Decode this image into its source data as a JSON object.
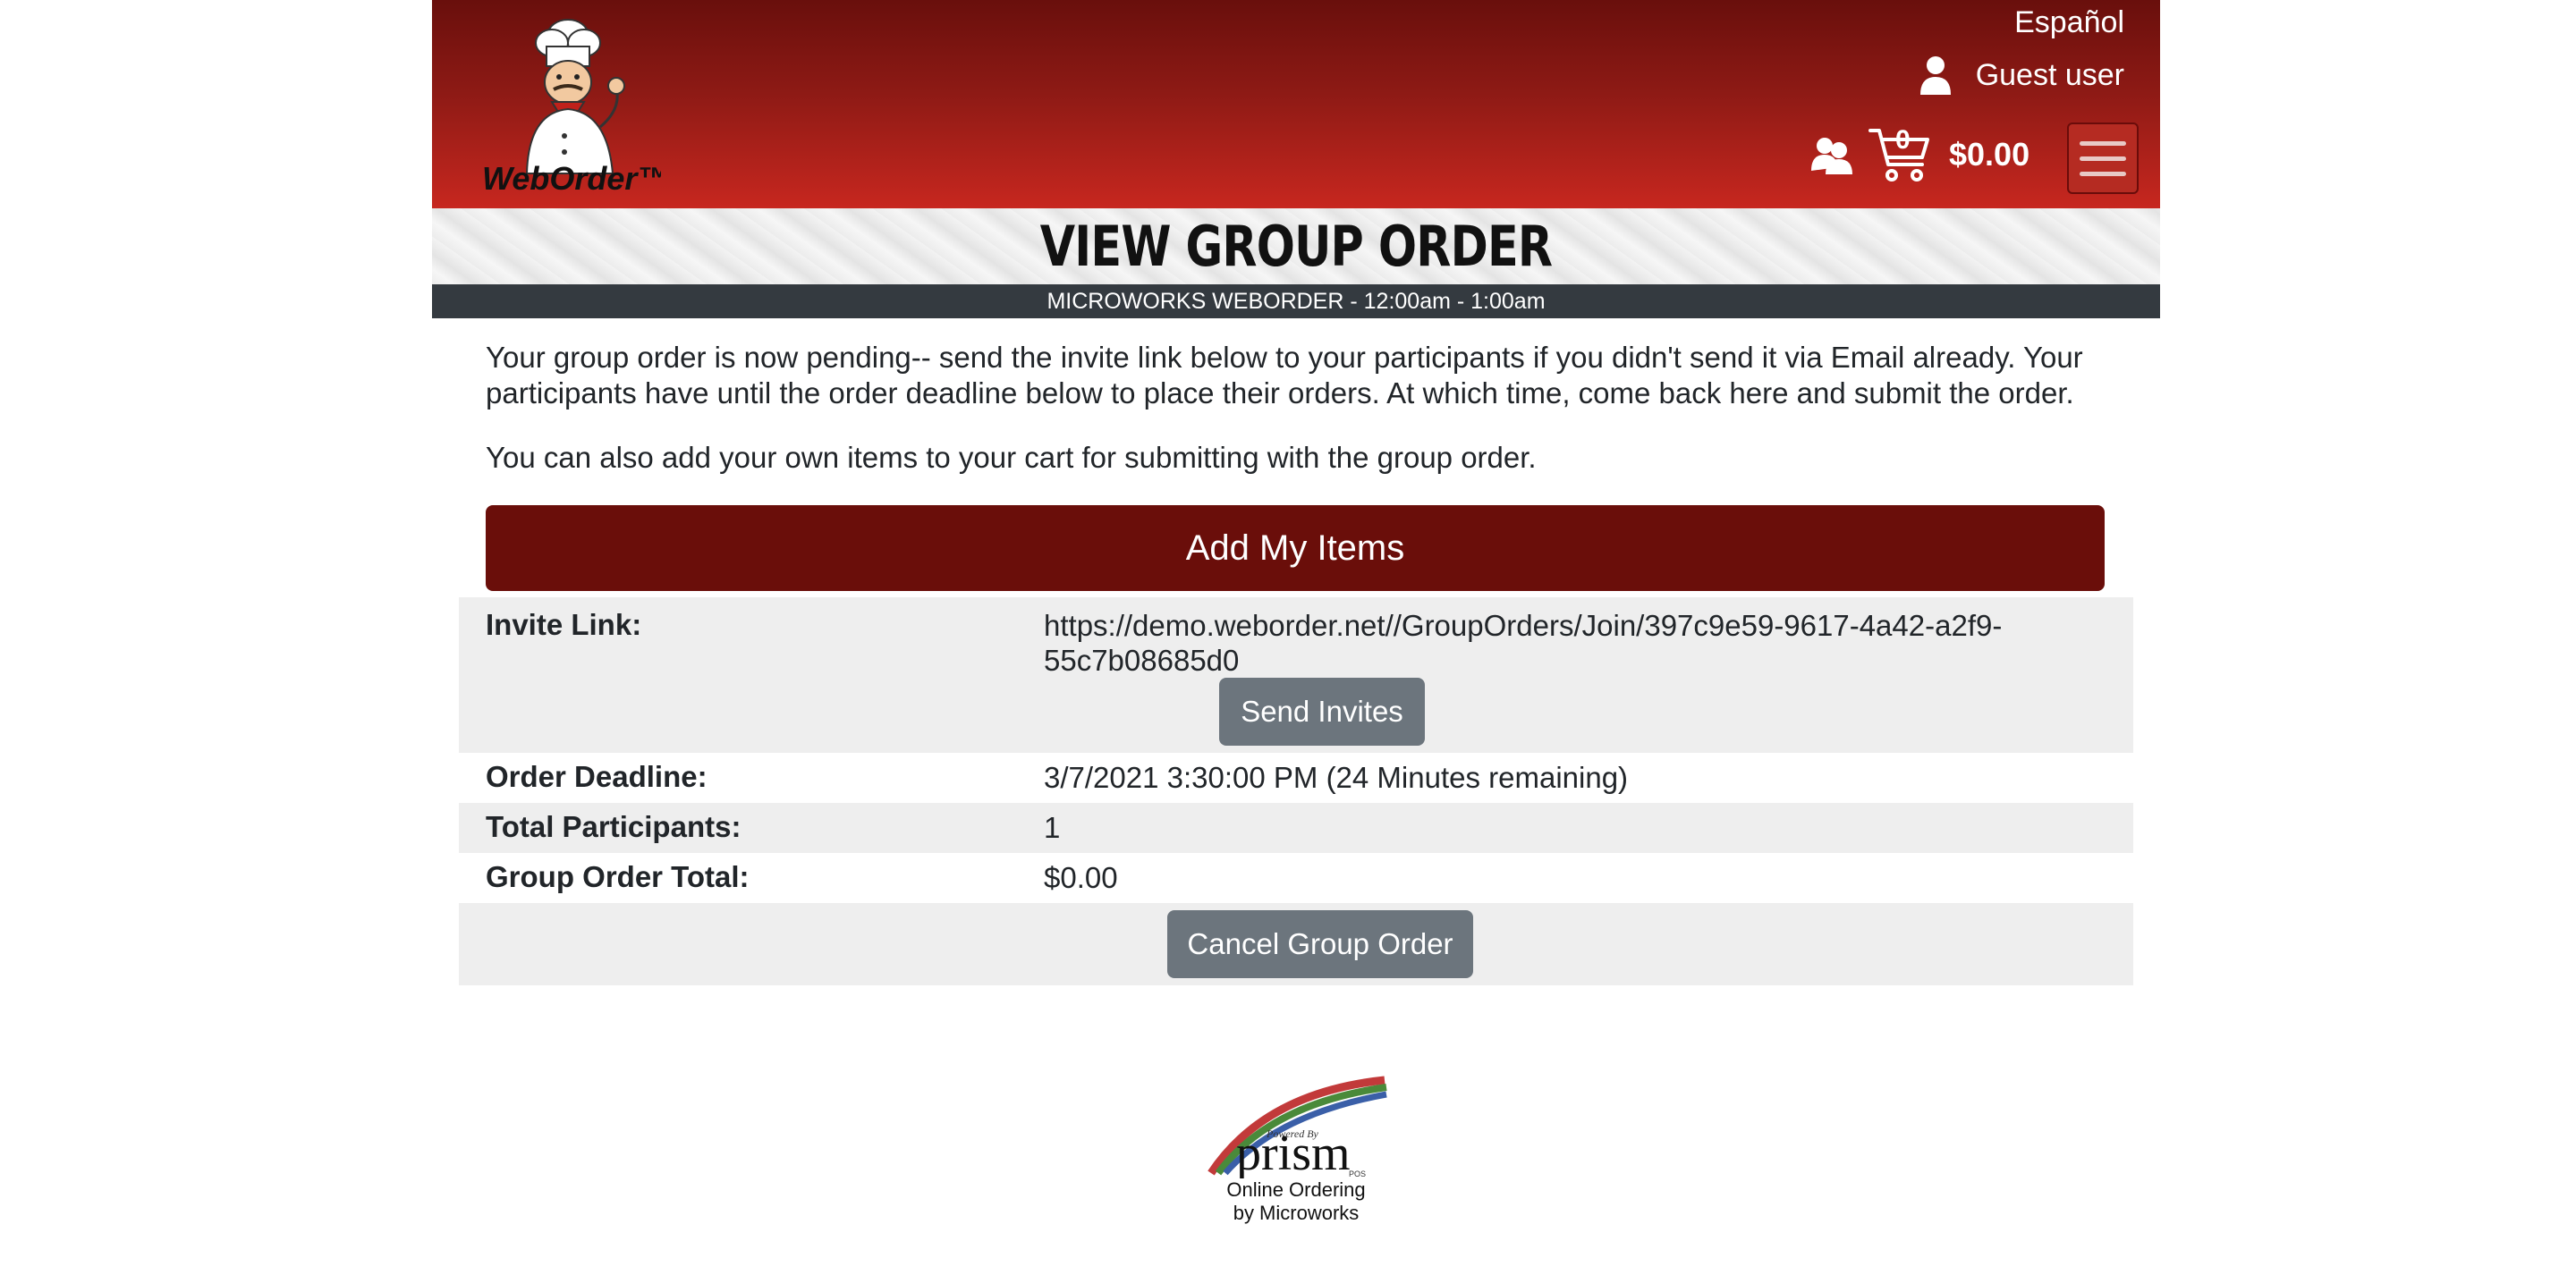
{
  "header": {
    "logo_text": "WebOrder™",
    "language_link": "Español",
    "user_name": "Guest user",
    "cart_count": "0",
    "cart_total": "$0.00"
  },
  "title_band": {
    "title": "VIEW GROUP ORDER",
    "hours": "MICROWORKS WEBORDER - 12:00am - 1:00am"
  },
  "content": {
    "paragraph_1": "Your group order is now pending-- send the invite link below to your participants if you didn't send it via Email already. Your participants have until the order deadline below to place their orders. At which time, come back here and submit the order.",
    "paragraph_2": "You can also add your own items to your cart for submitting with the group order.",
    "add_items_label": "Add My Items"
  },
  "info": {
    "invite_label": "Invite Link:",
    "invite_value": "https://demo.weborder.net//GroupOrders/Join/397c9e59-9617-4a42-a2f9-55c7b08685d0",
    "send_invites_label": "Send Invites",
    "deadline_label": "Order Deadline:",
    "deadline_value": "3/7/2021 3:30:00 PM (24 Minutes remaining)",
    "participants_label": "Total Participants:",
    "participants_value": "1",
    "total_label": "Group Order Total:",
    "total_value": "$0.00",
    "cancel_label": "Cancel Group Order"
  },
  "footer": {
    "powered_by": "Powered By",
    "brand": "prism",
    "brand_suffix": "POS",
    "line_1": "Online Ordering",
    "line_2": "by Microworks"
  },
  "colors": {
    "header_dark": "#690f0c",
    "header_light": "#c7271f",
    "primary_button": "#6a0e0a",
    "secondary_button": "#6c757d",
    "hours_bar": "#343a40",
    "row_alt": "#eeeeee"
  },
  "icons": [
    "chef-logo",
    "user-icon",
    "group-icon",
    "cart-icon",
    "hamburger-menu-icon",
    "prism-rainbow-logo"
  ]
}
